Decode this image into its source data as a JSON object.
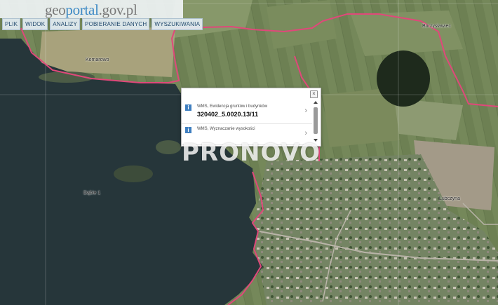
{
  "app": {
    "logo_geo": "geo",
    "logo_portal": "portal",
    "logo_gov": ".gov.pl"
  },
  "menu": {
    "items": [
      "PLIK",
      "WIDOK",
      "ANALIZY",
      "POBIERANIE DANYCH",
      "WYSZUKIWANIA"
    ]
  },
  "map": {
    "labels": {
      "komarowo": "Komarowo",
      "lake": "Dąbie 1",
      "top_right": "Borzysławiec",
      "lubczyna": "Lubczyna"
    },
    "colors": {
      "water": "#26363a",
      "boundary": "#e0487a",
      "land": "#6b7d56"
    }
  },
  "popup": {
    "rows": [
      {
        "source": "WMS, Ewidencja gruntów i budynków",
        "value": "320402_5.0020.13/11",
        "icon": "info-icon"
      },
      {
        "source": "WMS, Wyznaczanie wysokości",
        "value": "",
        "icon": "info-icon"
      }
    ]
  },
  "watermark": {
    "text": "PRONOVO"
  }
}
